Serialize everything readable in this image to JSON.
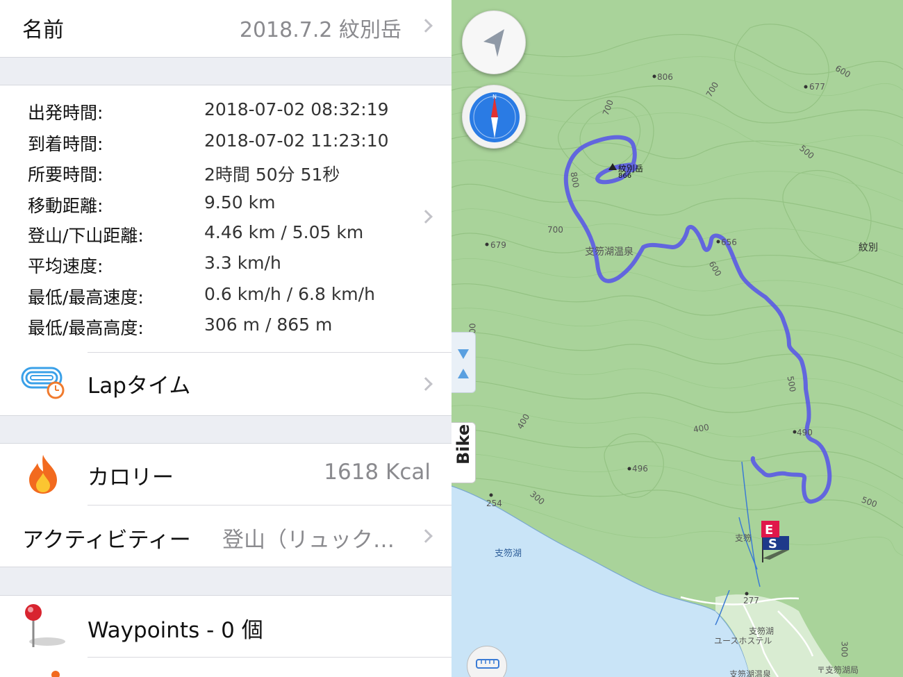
{
  "header": {
    "name_label": "名前",
    "name_value": "2018.7.2 紋別岳"
  },
  "stats": [
    {
      "label": "出発時間:",
      "value": "2018-07-02 08:32:19"
    },
    {
      "label": "到着時間:",
      "value": "2018-07-02 11:23:10"
    },
    {
      "label": "所要時間:",
      "value": "2時間 50分 51秒"
    },
    {
      "label": "移動距離:",
      "value": "9.50 km"
    },
    {
      "label": "登山/下山距離:",
      "value": "4.46 km / 5.05 km"
    },
    {
      "label": "平均速度:",
      "value": "3.3 km/h"
    },
    {
      "label": "最低/最高速度:",
      "value": "0.6 km/h / 6.8 km/h"
    },
    {
      "label": "最低/最高高度:",
      "value": "306 m / 865 m"
    }
  ],
  "lap": {
    "label": "Lapタイム"
  },
  "calorie": {
    "label": "カロリー",
    "value": "1618 Kcal"
  },
  "activity": {
    "label": "アクティビティー",
    "value": "登山（リュック…"
  },
  "waypoints": {
    "label": "Waypoints - 0 個"
  },
  "map": {
    "bike_label": "Bike",
    "labels": {
      "summit": "紋別岳",
      "summit_elev": "866",
      "onsen": "支笏湖温泉",
      "monbetsu": "紋別",
      "lake": "支笏湖",
      "youth_hostel_1": "支笏湖",
      "youth_hostel_2": "ユースホステル",
      "post_office": "〒支笏湖局",
      "onsen_bottom": "支笏湖温泉",
      "shikotsu_partial": "支笏",
      "e806": "806",
      "e677": "677",
      "e679": "679",
      "e656": "656",
      "e496": "496",
      "e490": "490",
      "e254": "254",
      "e277": "277",
      "c600a": "600",
      "c600b": "600",
      "c700a": "700",
      "c700b": "700",
      "c700c": "700",
      "c800": "800",
      "c500a": "500",
      "c500b": "500",
      "c500c": "500",
      "c400a": "400",
      "c400b": "400",
      "c300a": "300",
      "c300b": "300",
      "c00": "00"
    },
    "colors": {
      "track": "#5a5ae6",
      "terrain": "#a9d39a",
      "lake": "#c9e4f7",
      "end_flag": "#e0174a",
      "start_flag": "#1e3a8a"
    }
  }
}
